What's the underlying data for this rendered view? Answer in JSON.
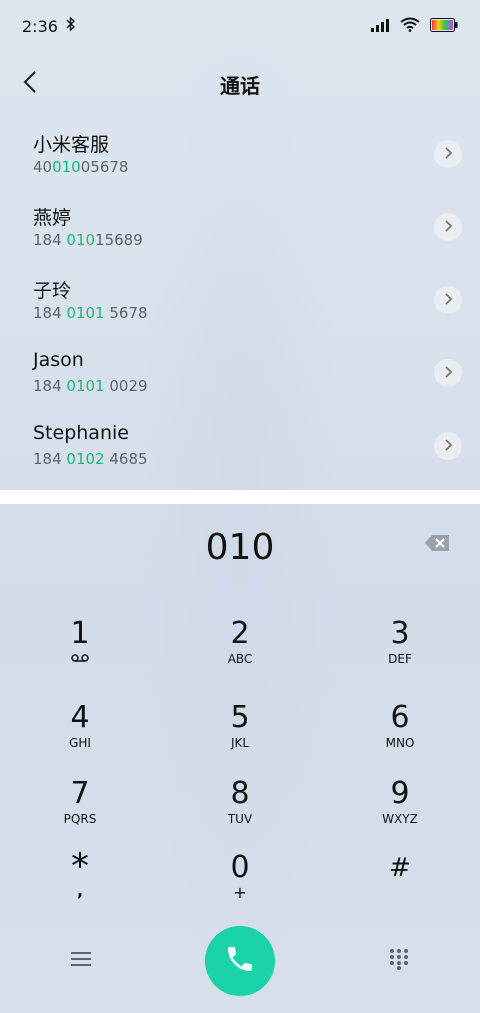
{
  "status_bar": {
    "time": "2:36",
    "bluetooth_icon": "bluetooth-icon",
    "signal_icon": "signal-icon",
    "wifi_icon": "wifi-icon",
    "battery_icon": "battery-icon"
  },
  "header": {
    "title": "通话",
    "back_icon": "back-arrow-icon"
  },
  "contacts": [
    {
      "name": "小米客服",
      "number_pre": "40",
      "number_hl": "010",
      "number_post": "05678"
    },
    {
      "name": "燕婷",
      "number_pre": "184 ",
      "number_hl": "010",
      "number_post": "15689"
    },
    {
      "name": "子玲",
      "number_pre": "184 ",
      "number_hl": "0101",
      "number_post": " 5678"
    },
    {
      "name": "Jason",
      "number_pre": "184 ",
      "number_hl": "0101",
      "number_post": " 0029"
    },
    {
      "name": "Stephanie",
      "number_pre": "184 ",
      "number_hl": "0102",
      "number_post": " 4685"
    }
  ],
  "dialer": {
    "input": "010",
    "backspace_icon": "backspace-icon"
  },
  "keypad": [
    {
      "digit": "1",
      "letters": "voicemail"
    },
    {
      "digit": "2",
      "letters": "ABC"
    },
    {
      "digit": "3",
      "letters": "DEF"
    },
    {
      "digit": "4",
      "letters": "GHI"
    },
    {
      "digit": "5",
      "letters": "JKL"
    },
    {
      "digit": "6",
      "letters": "MNO"
    },
    {
      "digit": "7",
      "letters": "PQRS"
    },
    {
      "digit": "8",
      "letters": "TUV"
    },
    {
      "digit": "9",
      "letters": "WXYZ"
    },
    {
      "digit": "*",
      "letters": ","
    },
    {
      "digit": "0",
      "letters": "+"
    },
    {
      "digit": "#",
      "letters": ""
    }
  ],
  "bottom_bar": {
    "menu_icon": "menu-icon",
    "call_icon": "phone-icon",
    "dialpad_icon": "dialpad-icon"
  },
  "colors": {
    "accent": "#19d3a6",
    "highlight": "#18b87a"
  }
}
